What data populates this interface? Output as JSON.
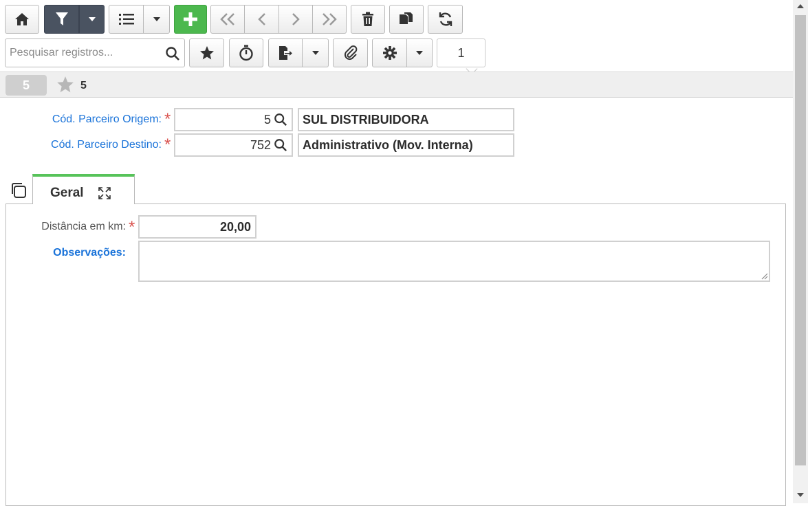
{
  "toolbar": {
    "row1": [
      {
        "name": "home-button",
        "icon": "home-icon"
      },
      {
        "name": "filter-button",
        "icon": "filter-icon"
      },
      {
        "name": "filter-dropdown-button",
        "icon": "caret-down-icon"
      },
      {
        "name": "list-view-button",
        "icon": "list-icon"
      },
      {
        "name": "list-view-dropdown-button",
        "icon": "caret-down-icon"
      },
      {
        "name": "add-record-button",
        "icon": "plus-icon"
      },
      {
        "name": "first-record-button",
        "icon": "double-chevron-left-icon"
      },
      {
        "name": "previous-record-button",
        "icon": "chevron-left-icon"
      },
      {
        "name": "next-record-button",
        "icon": "chevron-right-icon"
      },
      {
        "name": "last-record-button",
        "icon": "double-chevron-right-icon"
      },
      {
        "name": "delete-button",
        "icon": "trash-icon"
      },
      {
        "name": "duplicate-button",
        "icon": "copy-icon"
      },
      {
        "name": "refresh-button",
        "icon": "refresh-icon"
      }
    ],
    "search_placeholder": "Pesquisar registros...",
    "page_number": "1"
  },
  "record_bar": {
    "record_id": "5",
    "favorite_count": "5"
  },
  "form": {
    "origem": {
      "label": "Cód. Parceiro Origem:",
      "code": "5",
      "description": "SUL DISTRIBUIDORA"
    },
    "destino": {
      "label": "Cód. Parceiro Destino:",
      "code": "752",
      "description": "Administrativo (Mov. Interna)"
    }
  },
  "tabs": [
    {
      "label": "Geral",
      "active": true
    }
  ],
  "geral": {
    "distancia_label": "Distância em km:",
    "distancia_value": "20,00",
    "observacoes_label": "Observações:",
    "observacoes_value": ""
  },
  "colors": {
    "accent_blue": "#1a73d9",
    "required_red": "#d9534f",
    "green": "#4cb84e",
    "dark_button": "#4a5361",
    "tab_active": "#57c35a"
  }
}
